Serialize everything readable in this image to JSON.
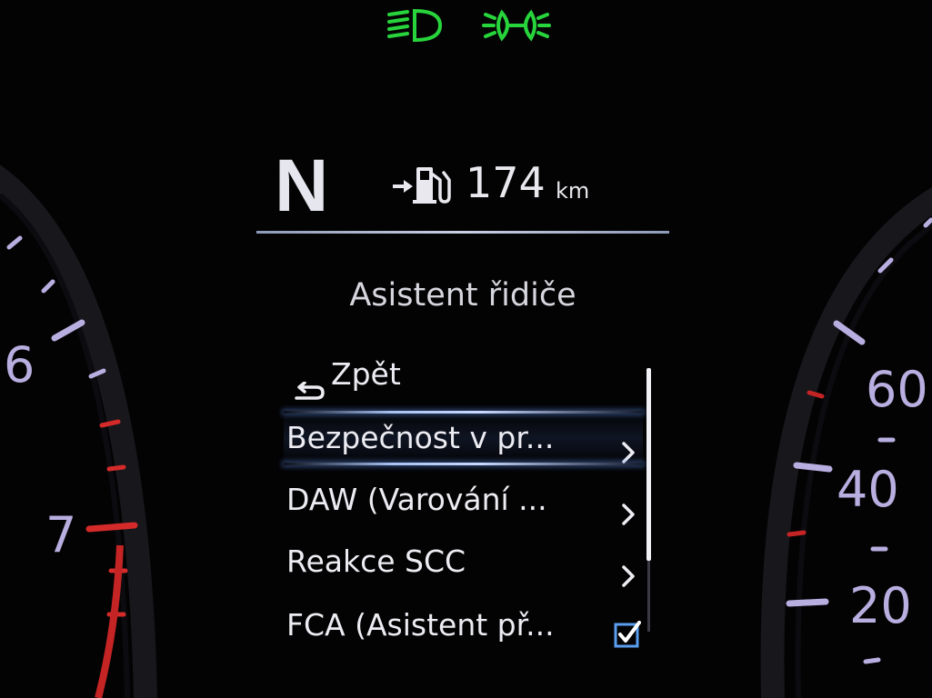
{
  "telltales": [
    {
      "icon": "low-beam-headlight-icon",
      "color": "#28d43c"
    },
    {
      "icon": "position-lights-icon",
      "color": "#28d43c"
    }
  ],
  "status": {
    "gear": "N",
    "range_value": "174",
    "range_unit": "km",
    "range_icon": "fuel-range-icon"
  },
  "menu": {
    "title": "Asistent řidiče",
    "back_label": "Zpět",
    "items": [
      {
        "label": "Bezpečnost v pr...",
        "type": "submenu",
        "selected": true
      },
      {
        "label": "DAW (Varování ...",
        "type": "submenu",
        "selected": false
      },
      {
        "label": "Reakce SCC",
        "type": "submenu",
        "selected": false
      },
      {
        "label": "FCA (Asistent př...",
        "type": "checkbox",
        "checked": true
      }
    ]
  },
  "gauges": {
    "left_labels": [
      "6",
      "7"
    ],
    "right_labels": [
      "60",
      "40",
      "20"
    ],
    "tick_color": "#b9aee0",
    "redline_color": "#d42a2a"
  },
  "colors": {
    "accent_telltale": "#28d43c",
    "selection_glow": "#a9c2f2",
    "checkbox": "#5a9ef0"
  }
}
